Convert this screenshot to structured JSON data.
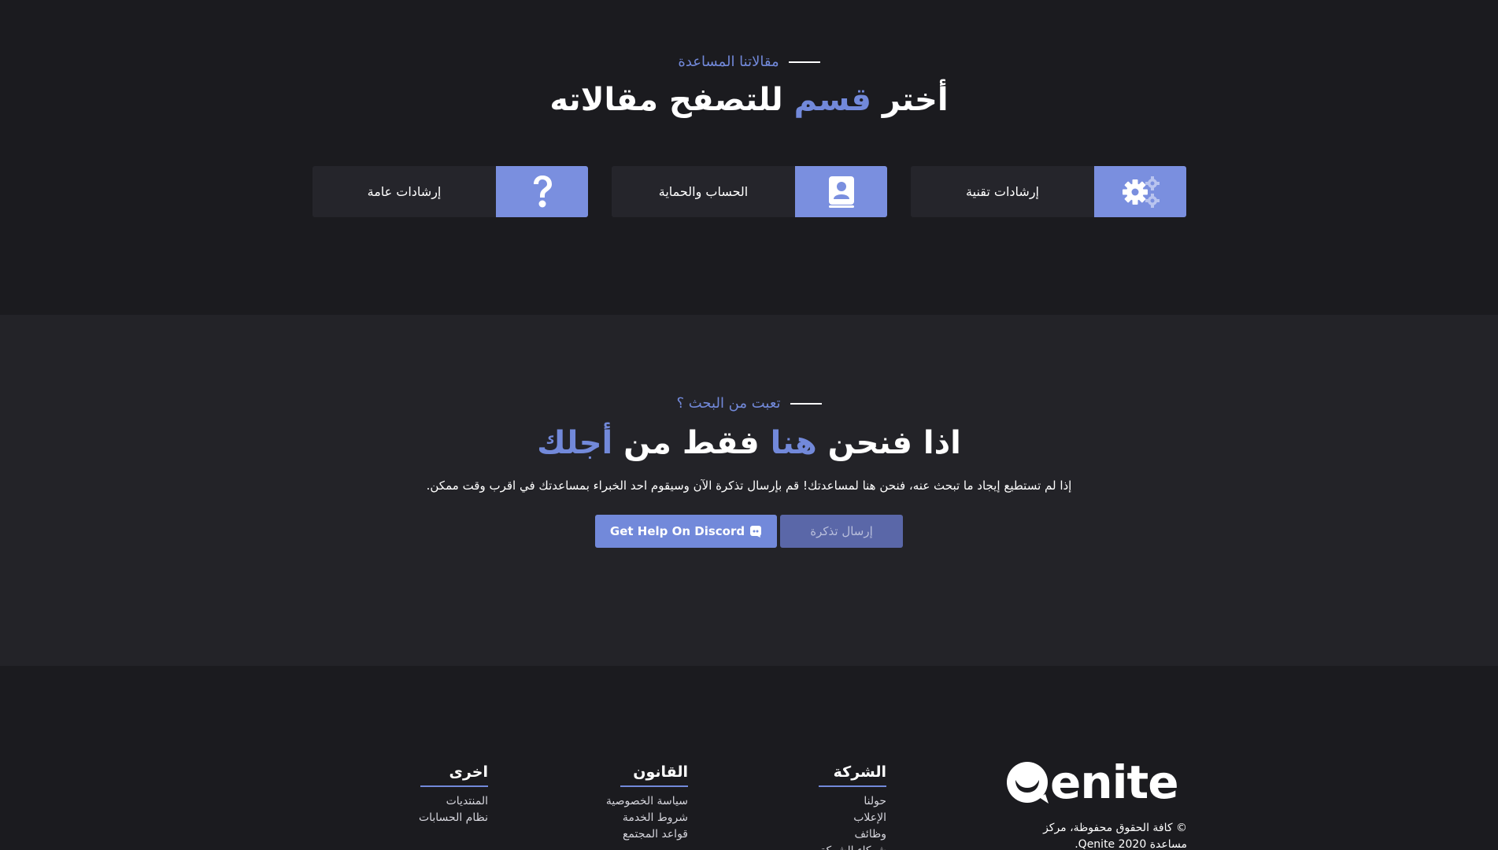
{
  "categories_section": {
    "eyebrow": "مقالاتنا المساعدة",
    "title_part1": "أختر ",
    "title_accent": "قسم",
    "title_part2": " للتصفح مقالاته",
    "cards": [
      {
        "label": "إرشادات تقنية",
        "icon": "gears-icon"
      },
      {
        "label": "الحساب والحماية",
        "icon": "contact-book-icon"
      },
      {
        "label": "إرشادات عامة",
        "icon": "question-mark-icon"
      }
    ]
  },
  "help_section": {
    "eyebrow": "تعبت من البحث ؟",
    "title_part1": "اذا فنحن ",
    "title_accent1": "هنا",
    "title_part2": " فقط من ",
    "title_accent2": "أجلك",
    "description": "إذا لم تستطيع إيجاد ما تبحث عنه، فنحن هنا لمساعدتك! قم بإرسال تذكرة الآن وسيقوم احد الخبراء بمساعدتك في اقرب وقت ممكن.",
    "discord_button": "Get Help On Discord",
    "ticket_button": "إرسال تذكرة"
  },
  "footer": {
    "logo_text": "enite",
    "copyright_line1": "© كافة الحقوق محفوظة، مركز",
    "copyright_line2": "مساعدة Qenite 2020.",
    "columns": [
      {
        "title": "الشركة",
        "links": [
          "حولنا",
          "الإعلاب",
          "وظائف",
          "شركاء الشركة"
        ]
      },
      {
        "title": "القانون",
        "links": [
          "سياسة الخصوصية",
          "شروط الخدمة",
          "قواعد المجتمع"
        ]
      },
      {
        "title": "اخرى",
        "links": [
          "المنتديات",
          "نظام الحسابات"
        ]
      }
    ]
  },
  "colors": {
    "background": "#1b1b1f",
    "section_alt": "#232328",
    "card": "#25252b",
    "accent": "#7289da",
    "icon_box": "#7a8fdf"
  }
}
